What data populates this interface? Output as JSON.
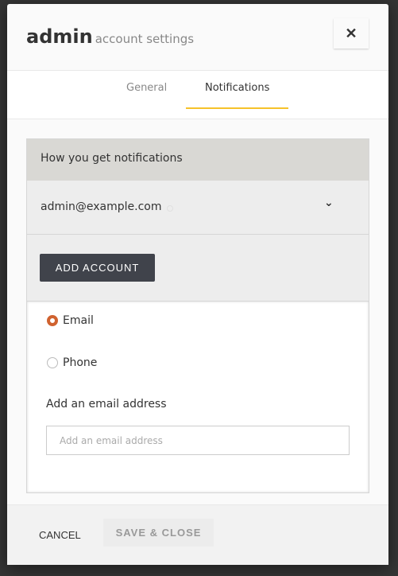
{
  "header": {
    "title": "admin",
    "subtitle": "account settings",
    "close_icon": "close-icon"
  },
  "tabs": [
    {
      "label": "General",
      "active": false
    },
    {
      "label": "Notifications",
      "active": true
    }
  ],
  "accent_color": "#f6c22b",
  "notifications": {
    "section_title": "How you get notifications",
    "account_email": "admin@example.com",
    "add_account_label": "ADD ACCOUNT",
    "methods": [
      {
        "label": "Email",
        "selected": true
      },
      {
        "label": "Phone",
        "selected": false
      }
    ],
    "email_field_label": "Add an email address",
    "email_field_placeholder": "Add an email address",
    "email_field_value": ""
  },
  "footer": {
    "cancel_label": "CANCEL",
    "save_label": "SAVE & CLOSE"
  }
}
